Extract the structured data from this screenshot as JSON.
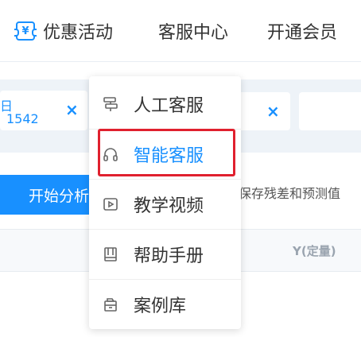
{
  "nav": {
    "promo_icon_glyph": "¥",
    "promo_label": "优惠活动",
    "service_label": "客服中心",
    "vip_label": "开通会员"
  },
  "filters": {
    "chip1_char": "日",
    "chip1_number": "1542",
    "close_glyph": "×"
  },
  "actions": {
    "start_label": "开始分析",
    "option_text": "保存残差和预测值"
  },
  "table": {
    "col_y": "Y(定量)"
  },
  "dropdown": {
    "items": [
      {
        "label": "人工客服",
        "icon": "signpost-icon"
      },
      {
        "label": "智能客服",
        "icon": "headset-icon"
      },
      {
        "label": "教学视频",
        "icon": "video-play-icon"
      },
      {
        "label": "帮助手册",
        "icon": "book-icon"
      },
      {
        "label": "案例库",
        "icon": "archive-icon"
      }
    ],
    "active_index": 1
  },
  "colors": {
    "accent": "#1890ff",
    "highlight": "#e0202e",
    "text": "#333333"
  }
}
